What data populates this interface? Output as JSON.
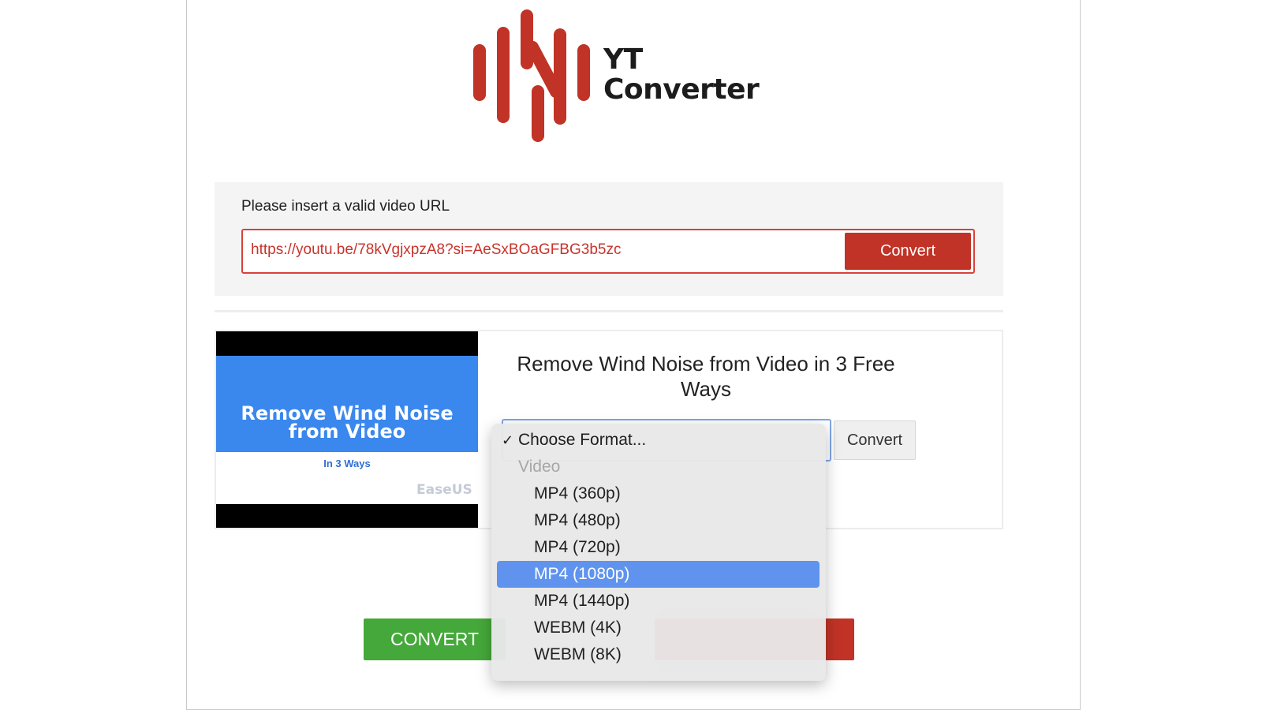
{
  "logo": {
    "line1": "YT",
    "line2": "Converter",
    "color": "#c03326"
  },
  "url_panel": {
    "label": "Please insert a valid video URL",
    "url_value": "https://youtu.be/78kVgjxpzA8?si=AeSxBOaGFBG3b5zc",
    "convert_label": "Convert"
  },
  "result": {
    "thumbnail": {
      "title": "Remove Wind Noise from Video",
      "subtitle": "In 3 Ways",
      "brand": "EaseUS"
    },
    "video_title": "Remove Wind Noise from Video in 3 Free Ways",
    "side_convert_label": "Convert"
  },
  "format_dropdown": {
    "choose": "Choose Format...",
    "group": "Video",
    "options": [
      "MP4 (360p)",
      "MP4 (480p)",
      "MP4 (720p)",
      "MP4 (1080p)",
      "MP4 (1440p)",
      "WEBM (4K)",
      "WEBM (8K)"
    ],
    "selected": "MP4 (1080p)"
  },
  "bottom": {
    "convert_label": "CONVERT"
  },
  "colors": {
    "accent_red": "#c03326",
    "green": "#45a83a",
    "select_blue": "#5f93ee"
  }
}
